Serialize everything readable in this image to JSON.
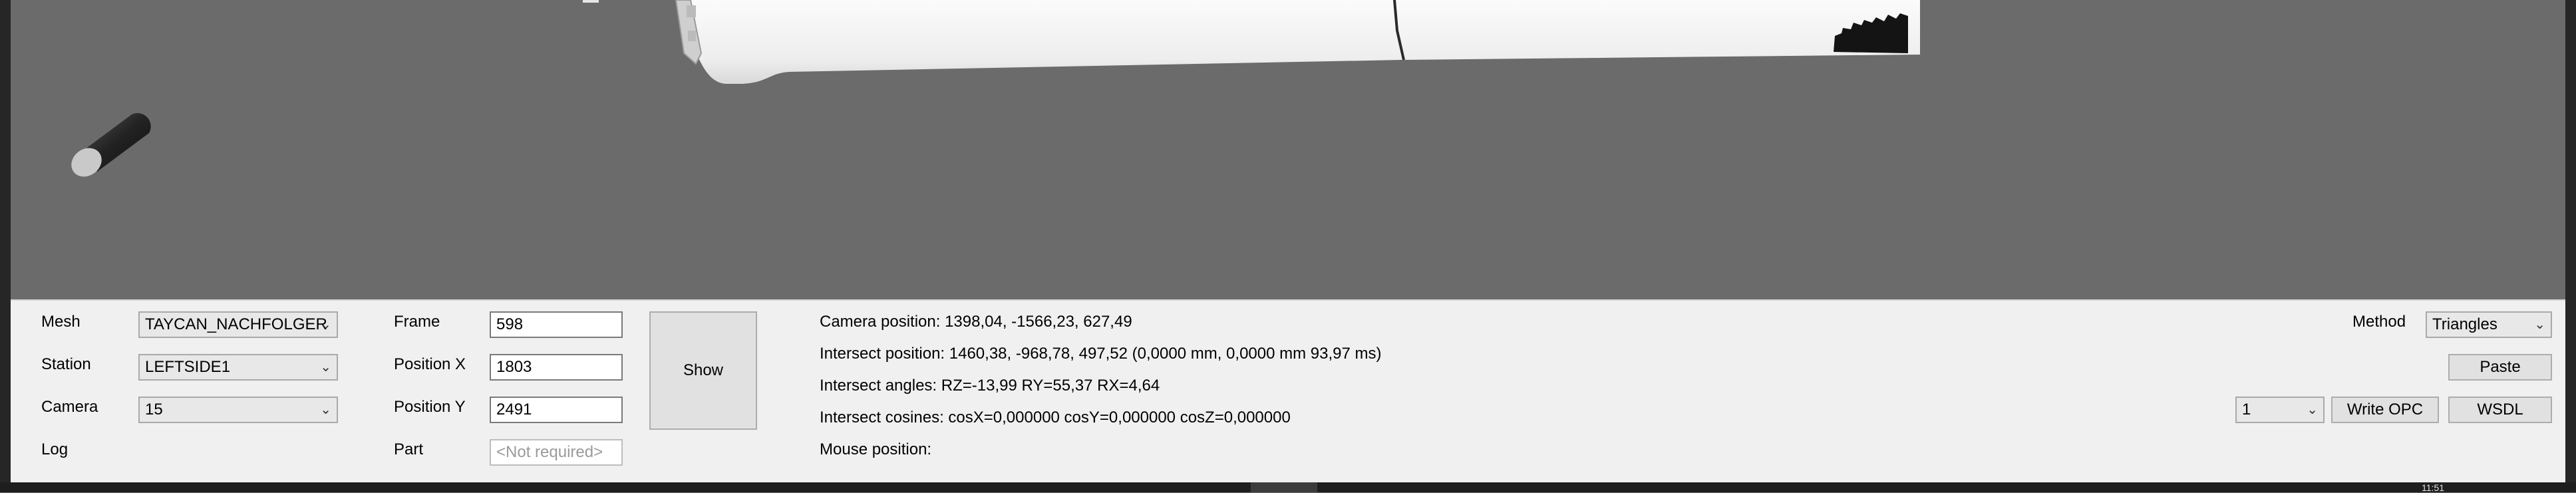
{
  "form": {
    "mesh_label": "Mesh",
    "mesh_value": "TAYCAN_NACHFOLGER",
    "station_label": "Station",
    "station_value": "LEFTSIDE1",
    "camera_label": "Camera",
    "camera_value": "15",
    "log_label": "Log",
    "frame_label": "Frame",
    "frame_value": "598",
    "posx_label": "Position X",
    "posx_value": "1803",
    "posy_label": "Position Y",
    "posy_value": "2491",
    "part_label": "Part",
    "part_placeholder": "<Not required>"
  },
  "buttons": {
    "show": "Show",
    "paste": "Paste",
    "write_opc": "Write OPC",
    "wsdl": "WSDL"
  },
  "method": {
    "label": "Method",
    "value": "Triangles"
  },
  "opc_select_value": "1",
  "info": {
    "camera_position": "Camera position: 1398,04, -1566,23, 627,49",
    "intersect_position": "Intersect position: 1460,38, -968,78, 497,52 (0,0000 mm, 0,0000 mm 93,97 ms)",
    "intersect_angles": "Intersect angles: RZ=-13,99 RY=55,37 RX=4,64",
    "intersect_cosines": "Intersect cosines: cosX=0,000000 cosY=0,000000 cosZ=0,000000",
    "mouse_position": "Mouse position:"
  },
  "taskbar": {
    "clock": "11:51"
  },
  "icons": {
    "dropdown": "chevron-down-icon"
  },
  "colors": {
    "viewport_bg": "#6b6b6b",
    "panel_bg": "#f0f0f0",
    "model": "#f2f2f2"
  }
}
